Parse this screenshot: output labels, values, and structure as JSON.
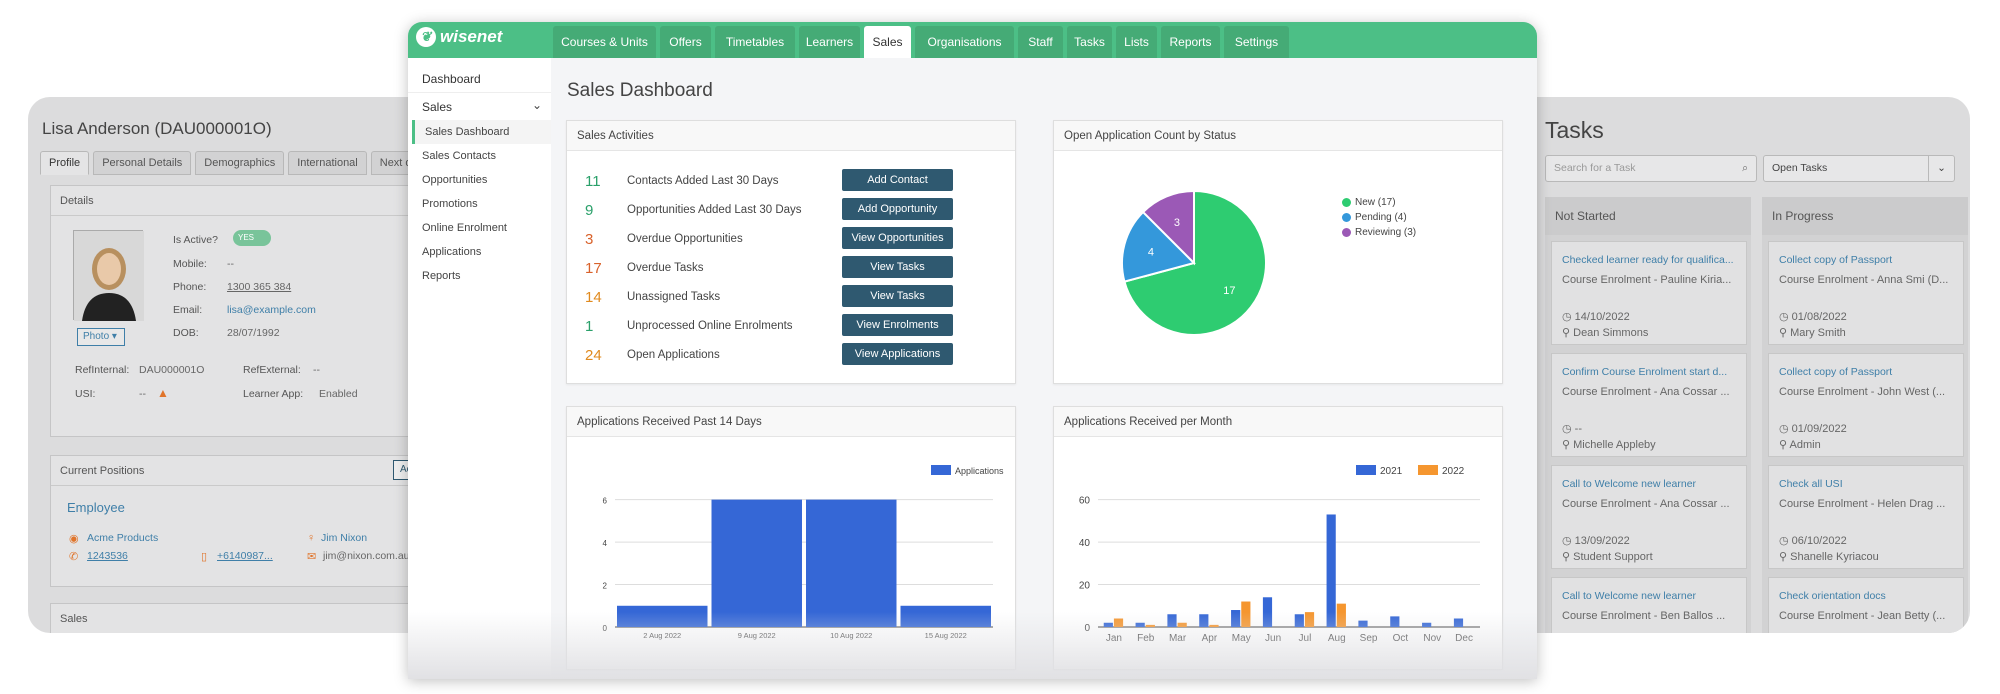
{
  "profile": {
    "name_title": "Lisa Anderson (DAU000001O)",
    "tabs": [
      "Profile",
      "Personal Details",
      "Demographics",
      "International",
      "Next of Kin"
    ],
    "details_heading": "Details",
    "photo_button": "Photo",
    "fields": [
      {
        "label": "Is Active?",
        "value": "YES"
      },
      {
        "label": "Mobile:",
        "value": "--"
      },
      {
        "label": "Phone:",
        "value": "1300 365 384"
      },
      {
        "label": "Email:",
        "value": "lisa@example.com"
      },
      {
        "label": "DOB:",
        "value": "28/07/1992"
      }
    ],
    "ref_internal_label": "RefInternal:",
    "ref_internal_value": "DAU000001O",
    "ref_external_label": "RefExternal:",
    "ref_external_value": "--",
    "usi_label": "USI:",
    "usi_value": "--",
    "learner_app_label": "Learner App:",
    "learner_app_value": "Enabled",
    "positions_heading": "Current Positions",
    "action_button": "Action",
    "position_title": "Employee",
    "company": "Acme Products",
    "contact_person": "Jim Nixon",
    "company_phone": "1243536",
    "contact_mobile": "+6140987...",
    "contact_email": "jim@nixon.com.au",
    "sales_heading": "Sales",
    "e_fragment": "E"
  },
  "tasks": {
    "title": "Tasks",
    "search_placeholder": "Search for a Task",
    "filter_value": "Open Tasks",
    "columns": [
      {
        "header": "Not Started",
        "cards": [
          {
            "title": "Checked learner ready for qualifica...",
            "subtitle": "Course Enrolment - Pauline Kiria...",
            "date": "14/10/2022",
            "user": "Dean Simmons"
          },
          {
            "title": "Confirm Course Enrolment start d...",
            "subtitle": "Course Enrolment - Ana Cossar ...",
            "date": "--",
            "user": "Michelle Appleby"
          },
          {
            "title": "Call to Welcome new learner",
            "subtitle": "Course Enrolment - Ana Cossar ...",
            "date": "13/09/2022",
            "user": "Student Support"
          },
          {
            "title": "Call to Welcome new learner",
            "subtitle": "Course Enrolment - Ben Ballos ...",
            "date": "",
            "user": ""
          }
        ]
      },
      {
        "header": "In Progress",
        "cards": [
          {
            "title": "Collect copy of Passport",
            "subtitle": "Course Enrolment - Anna Smi (D...",
            "date": "01/08/2022",
            "user": "Mary Smith"
          },
          {
            "title": "Collect copy of Passport",
            "subtitle": "Course Enrolment - John West (...",
            "date": "01/09/2022",
            "user": "Admin"
          },
          {
            "title": "Check all USI",
            "subtitle": "Course Enrolment - Helen Drag ...",
            "date": "06/10/2022",
            "user": "Shanelle Kyriacou"
          },
          {
            "title": "Check orientation docs",
            "subtitle": "Course Enrolment - Jean Betty (...",
            "date": "",
            "user": ""
          }
        ]
      }
    ]
  },
  "app": {
    "brand": "wisenet",
    "nav": [
      "Courses & Units",
      "Offers",
      "Timetables",
      "Learners",
      "Sales",
      "Organisations",
      "Staff",
      "Tasks",
      "Lists",
      "Reports",
      "Settings"
    ],
    "active_nav": "Sales",
    "sidebar": {
      "dashboard": "Dashboard",
      "section": "Sales",
      "items": [
        "Sales Dashboard",
        "Sales Contacts",
        "Opportunities",
        "Promotions",
        "Online Enrolment",
        "Applications",
        "Reports"
      ]
    }
  },
  "dashboard": {
    "title": "Sales Dashboard",
    "activities": {
      "heading": "Sales Activities",
      "rows": [
        {
          "count": "11",
          "label": "Contacts Added Last 30 Days",
          "button": "Add Contact",
          "color": "#2aa06a"
        },
        {
          "count": "9",
          "label": "Opportunities Added Last 30 Days",
          "button": "Add Opportunity",
          "color": "#2aa06a"
        },
        {
          "count": "3",
          "label": "Overdue Opportunities",
          "button": "View Opportunities",
          "color": "#d9622b"
        },
        {
          "count": "17",
          "label": "Overdue Tasks",
          "button": "View Tasks",
          "color": "#d9622b"
        },
        {
          "count": "14",
          "label": "Unassigned Tasks",
          "button": "View Tasks",
          "color": "#e08a1e"
        },
        {
          "count": "1",
          "label": "Unprocessed Online Enrolments",
          "button": "View Enrolments",
          "color": "#2aa06a"
        },
        {
          "count": "24",
          "label": "Open Applications",
          "button": "View Applications",
          "color": "#e08a1e"
        }
      ]
    },
    "pie_heading": "Open Application Count by Status",
    "bar14_heading": "Applications Received Past 14 Days",
    "month_heading": "Applications Received per Month"
  },
  "chart_data": [
    {
      "type": "pie",
      "title": "Open Application Count by Status",
      "slices": [
        {
          "label": "New (17)",
          "value": 17,
          "color": "#2ecc71"
        },
        {
          "label": "Pending (4)",
          "value": 4,
          "color": "#3498db"
        },
        {
          "label": "Reviewing (3)",
          "value": 3,
          "color": "#9b59b6"
        }
      ]
    },
    {
      "type": "bar",
      "title": "Applications Received Past 14 Days",
      "categories": [
        "2 Aug 2022",
        "9 Aug 2022",
        "10 Aug 2022",
        "15 Aug 2022"
      ],
      "series": [
        {
          "name": "Applications",
          "values": [
            1,
            6,
            6,
            1
          ]
        }
      ],
      "yticks": [
        "0",
        "2",
        "4",
        "6"
      ],
      "ylim": [
        0,
        6.5
      ],
      "color": "#3567d6"
    },
    {
      "type": "bar",
      "title": "Applications Received per Month",
      "categories": [
        "Jan",
        "Feb",
        "Mar",
        "Apr",
        "May",
        "Jun",
        "Jul",
        "Aug",
        "Sep",
        "Oct",
        "Nov",
        "Dec"
      ],
      "series": [
        {
          "name": "2021",
          "values": [
            2,
            2,
            6,
            6,
            8,
            14,
            6,
            53,
            3,
            5,
            2,
            4
          ],
          "color": "#3567d6"
        },
        {
          "name": "2022",
          "values": [
            4,
            1,
            2,
            1,
            12,
            0,
            7,
            11,
            0,
            0,
            0,
            0
          ],
          "color": "#f5962f"
        }
      ],
      "yticks": [
        "0",
        "20",
        "40",
        "60"
      ],
      "ylim": [
        0,
        65
      ]
    }
  ]
}
